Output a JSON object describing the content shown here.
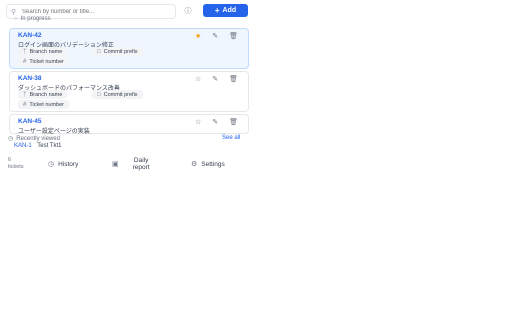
{
  "search": {
    "placeholder": "Search by number or title...",
    "value": ""
  },
  "header": {
    "add_label": "Add"
  },
  "sections": {
    "in_progress_label": "In progress"
  },
  "tickets": [
    {
      "key": "KAN-42",
      "title": "ログイン画面のバリデーション修正",
      "starred": true,
      "chips": {
        "branch": "Branch name",
        "commit": "Commit prefix",
        "ticket": "Ticket number"
      }
    },
    {
      "key": "KAN-38",
      "title": "ダッシュボードのパフォーマンス改善",
      "starred": false,
      "chips": {
        "branch": "Branch name",
        "commit": "Commit prefix",
        "ticket": "Ticket number"
      }
    },
    {
      "key": "KAN-45",
      "title": "ユーザー設定ページの実装",
      "starred": false
    }
  ],
  "recent": {
    "label": "Recently viewed",
    "see_all": "See all",
    "items": [
      {
        "key": "KAN-1",
        "title": "Test Tkt1"
      }
    ]
  },
  "footer": {
    "count": "6",
    "count_unit": "tickets",
    "history_label": "History",
    "daily_report_line1": "Daily",
    "daily_report_line2": "report",
    "settings_label": "Settings"
  },
  "colors": {
    "accent": "#2563eb",
    "star": "#f59e0b",
    "active_card_bg": "#eff6ff"
  }
}
